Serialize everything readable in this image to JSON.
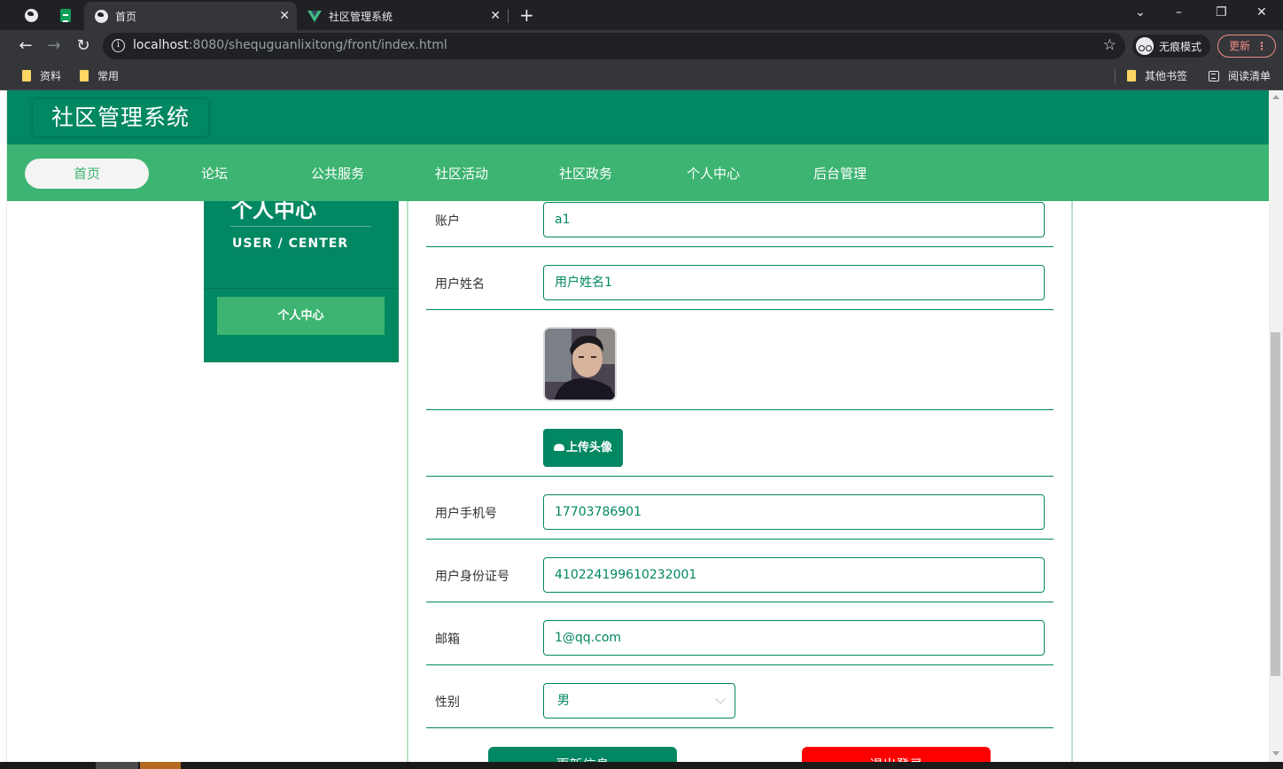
{
  "browser": {
    "tabs": [
      {
        "title": "首页",
        "icon": "globe-icon"
      },
      {
        "title": "社区管理系统",
        "icon": "vue-icon"
      }
    ],
    "close_glyph": "✕",
    "new_tab_glyph": "+",
    "url_host": "localhost",
    "url_rest": ":8080/shequguanlixitong/front/index.html",
    "incognito_label": "无痕模式",
    "update_label": "更新",
    "bookmarks": [
      {
        "label": "资料"
      },
      {
        "label": "常用"
      }
    ],
    "other_bookmarks": "其他书签",
    "reading_list": "阅读清单"
  },
  "header": {
    "site_title": "社区管理系统"
  },
  "nav": {
    "items": [
      {
        "label": "首页",
        "active": true
      },
      {
        "label": "论坛"
      },
      {
        "label": "公共服务"
      },
      {
        "label": "社区活动"
      },
      {
        "label": "社区政务"
      },
      {
        "label": "个人中心"
      },
      {
        "label": "后台管理"
      }
    ]
  },
  "sidebar": {
    "title": "个人中心",
    "subtitle": "USER / CENTER",
    "menu_item": "个人中心"
  },
  "form": {
    "account_label": "账户",
    "account_value": "a1",
    "name_label": "用户姓名",
    "name_value": "用户姓名1",
    "upload_label": "上传头像",
    "phone_label": "用户手机号",
    "phone_value": "17703786901",
    "idcard_label": "用户身份证号",
    "idcard_value": "410224199610232001",
    "email_label": "邮箱",
    "email_value": "1@qq.com",
    "gender_label": "性别",
    "gender_value": "男"
  },
  "buttons": {
    "save": "更新信息",
    "logout": "退出登录"
  },
  "colors": {
    "primary": "#018762",
    "nav_green": "#3db471",
    "danger": "#ff0000"
  }
}
